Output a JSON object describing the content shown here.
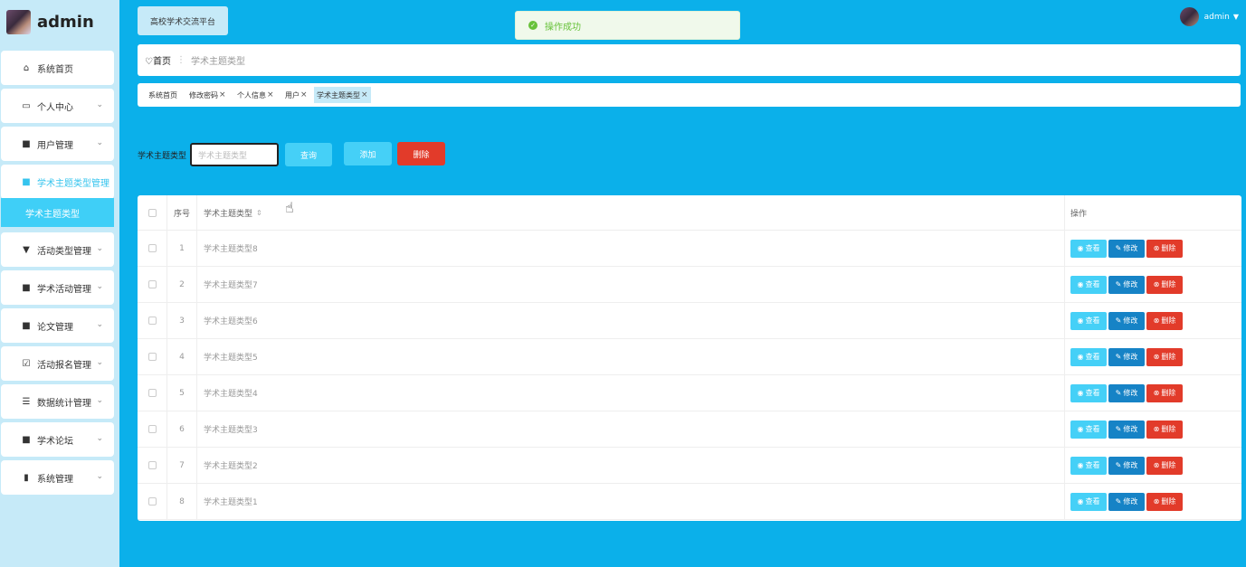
{
  "brand": {
    "title": "admin"
  },
  "sidebar": {
    "items": [
      {
        "label": "系统首页",
        "icon": "home-icon"
      },
      {
        "label": "个人中心",
        "icon": "calendar-icon"
      },
      {
        "label": "用户管理",
        "icon": "grid-icon"
      },
      {
        "label": "学术主题类型管理",
        "icon": "grid-icon"
      },
      {
        "label": "活动类型管理",
        "icon": "pin-icon"
      },
      {
        "label": "学术活动管理",
        "icon": "grid-icon"
      },
      {
        "label": "论文管理",
        "icon": "grid-icon"
      },
      {
        "label": "活动报名管理",
        "icon": "clipboard-icon"
      },
      {
        "label": "数据统计管理",
        "icon": "list-icon"
      },
      {
        "label": "学术论坛",
        "icon": "grid-icon"
      },
      {
        "label": "系统管理",
        "icon": "bar-chart-icon"
      }
    ],
    "sub_item": "学术主题类型"
  },
  "header": {
    "platform": "高校学术交流平台",
    "toast": "操作成功",
    "user": "admin"
  },
  "breadcrumb": {
    "home": "首页",
    "current": "学术主题类型"
  },
  "tags": [
    "系统首页",
    "修改密码",
    "个人信息",
    "用户",
    "学术主题类型"
  ],
  "search": {
    "label": "学术主题类型",
    "placeholder": "学术主题类型",
    "query": "查询",
    "add": "添加",
    "delete": "删除"
  },
  "table": {
    "headers": {
      "index": "序号",
      "name": "学术主题类型",
      "ops": "操作"
    },
    "rows": [
      {
        "index": "1",
        "name": "学术主题类型8"
      },
      {
        "index": "2",
        "name": "学术主题类型7"
      },
      {
        "index": "3",
        "name": "学术主题类型6"
      },
      {
        "index": "4",
        "name": "学术主题类型5"
      },
      {
        "index": "5",
        "name": "学术主题类型4"
      },
      {
        "index": "6",
        "name": "学术主题类型3"
      },
      {
        "index": "7",
        "name": "学术主题类型2"
      },
      {
        "index": "8",
        "name": "学术主题类型1"
      }
    ],
    "ops": {
      "view": "查看",
      "edit": "修改",
      "delete": "删除"
    }
  },
  "colors": {
    "accent": "#0bb0ea",
    "sidebar_bg": "#c6eaf8",
    "button": "#45d0f7",
    "danger": "#e23b2a",
    "edit": "#1683c6"
  }
}
